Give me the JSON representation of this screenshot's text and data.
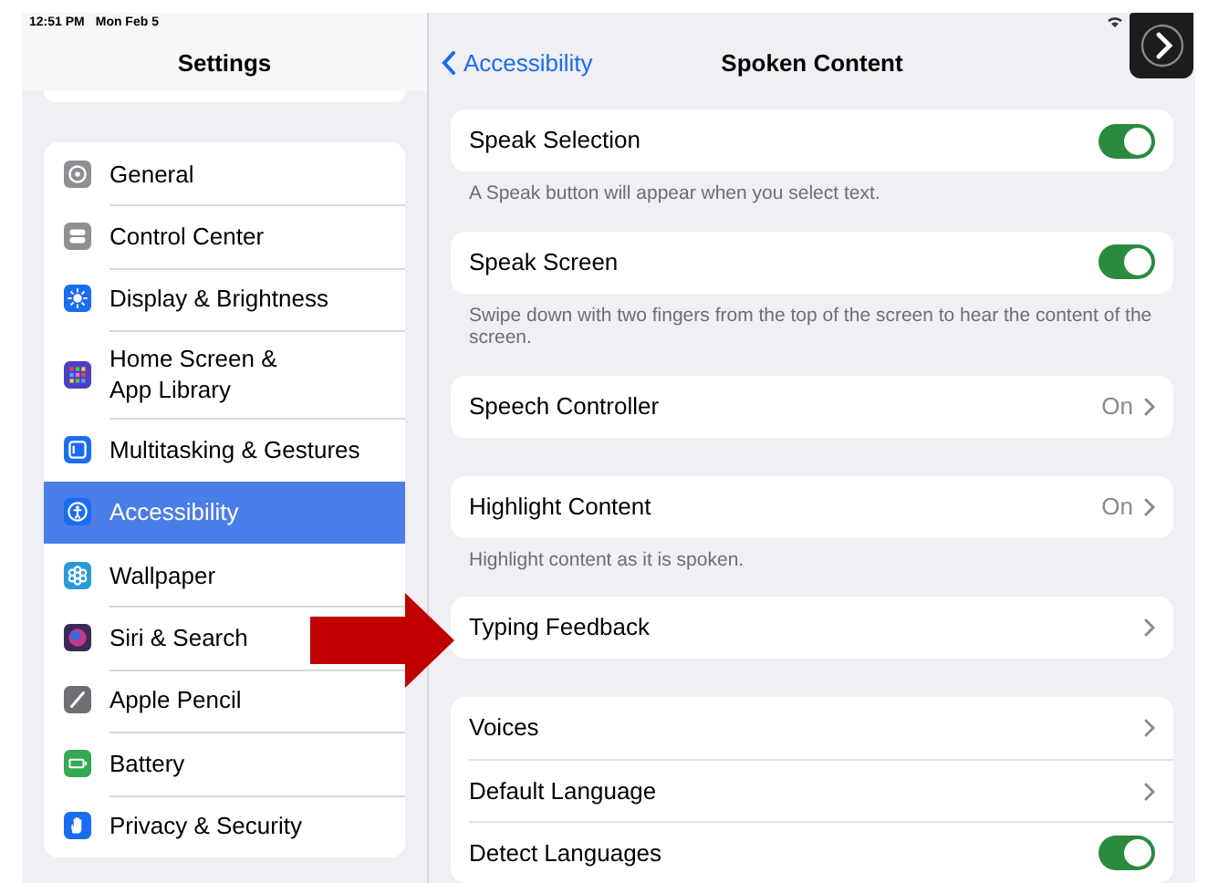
{
  "status_bar": {
    "time": "12:51 PM",
    "date": "Mon Feb 5"
  },
  "sidebar": {
    "title": "Settings",
    "items": [
      {
        "label": "General",
        "selected": false,
        "color": "#8e8e93"
      },
      {
        "label": "Control Center",
        "selected": false,
        "color": "#8e8e93"
      },
      {
        "label": "Display & Brightness",
        "selected": false,
        "color": "#1a6cf0"
      },
      {
        "label": "Home Screen &\nApp Library",
        "selected": false,
        "color": "#4b3fc4"
      },
      {
        "label": "Multitasking & Gestures",
        "selected": false,
        "color": "#1a6cf0"
      },
      {
        "label": "Accessibility",
        "selected": true,
        "color": "#1a6cf0"
      },
      {
        "label": "Wallpaper",
        "selected": false,
        "color": "#2a9bd6"
      },
      {
        "label": "Siri & Search",
        "selected": false,
        "color": "#3a2a5a"
      },
      {
        "label": "Apple Pencil",
        "selected": false,
        "color": "#6e6e73"
      },
      {
        "label": "Battery",
        "selected": false,
        "color": "#34a853"
      },
      {
        "label": "Privacy & Security",
        "selected": false,
        "color": "#1a6cf0"
      }
    ]
  },
  "nav": {
    "back_label": "Accessibility",
    "title": "Spoken Content"
  },
  "groups": [
    {
      "rows": [
        {
          "label": "Speak Selection",
          "kind": "toggle",
          "on": true
        }
      ],
      "footer": "A Speak button will appear when you select text."
    },
    {
      "rows": [
        {
          "label": "Speak Screen",
          "kind": "toggle",
          "on": true
        }
      ],
      "footer": "Swipe down with two fingers from the top of the screen to hear the content of the screen."
    },
    {
      "rows": [
        {
          "label": "Speech Controller",
          "kind": "link",
          "value": "On"
        }
      ]
    },
    {
      "rows": [
        {
          "label": "Highlight Content",
          "kind": "link",
          "value": "On"
        }
      ],
      "footer": "Highlight content as it is spoken."
    },
    {
      "rows": [
        {
          "label": "Typing Feedback",
          "kind": "link"
        }
      ]
    },
    {
      "rows": [
        {
          "label": "Voices",
          "kind": "link"
        },
        {
          "label": "Default Language",
          "kind": "link"
        },
        {
          "label": "Detect Languages",
          "kind": "toggle",
          "on": true
        }
      ]
    }
  ]
}
